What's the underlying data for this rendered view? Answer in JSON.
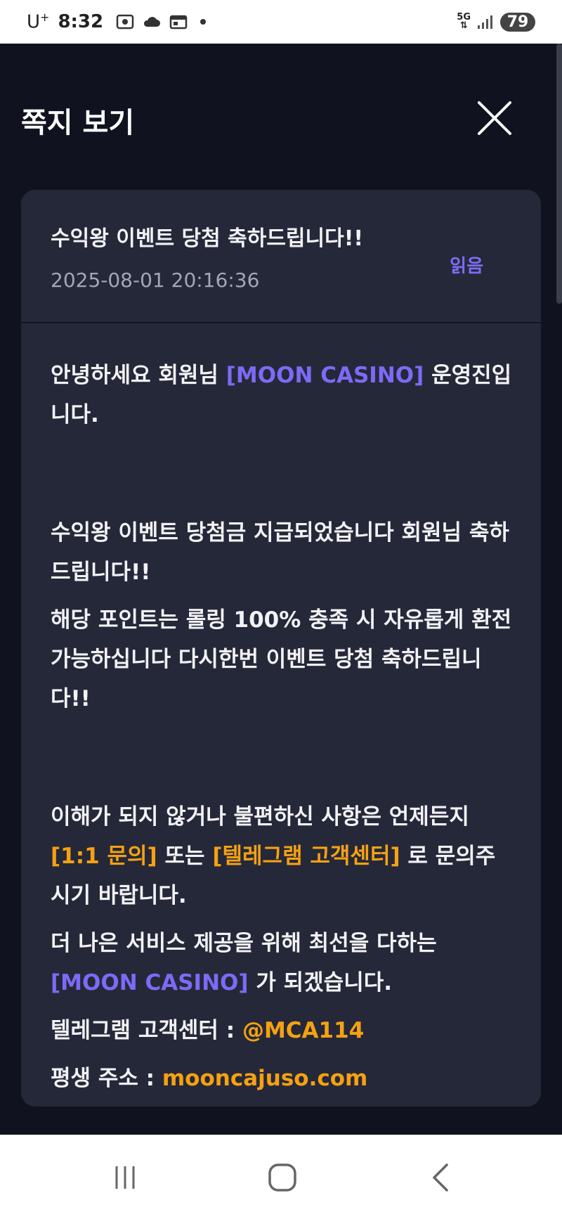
{
  "status_bar": {
    "carrier": "U",
    "carrier_sup": "+",
    "time": "8:32",
    "network": "5G",
    "battery": "79"
  },
  "header": {
    "title": "쪽지 보기",
    "close_icon": "close-icon"
  },
  "message": {
    "title": "수익왕 이벤트 당첨 축하드립니다!!",
    "datetime": "2025-08-01 20:16:36",
    "status": "읽음",
    "body": {
      "p1_a": "안녕하세요 회원님 ",
      "p1_brand": "[MOON CASINO]",
      "p1_b": " 운영진입니다.",
      "p2": "수익왕 이벤트 당첨금 지급되었습니다 회원님 축하드립니다!!",
      "p3": "해당 포인트는 롤링 100% 충족 시 자유롭게 환전 가능하십니다 다시한번 이벤트 당첨 축하드립니다!!",
      "p4_a": "이해가 되지 않거나 불편하신 사항은 언제든지 ",
      "p4_link1": "[1:1 문의]",
      "p4_b": " 또는 ",
      "p4_link2": "[텔레그램 고객센터]",
      "p4_c": " 로 문의주시기 바랍니다.",
      "p5_a": "더 나은 서비스 제공을 위해 최선을 다하는 ",
      "p5_brand": "[MOON CASINO]",
      "p5_b": " 가 되겠습니다.",
      "telegram_label": "텔레그램 고객센터 : ",
      "telegram_value": "@MCA114",
      "address_label": "평생 주소 : ",
      "address_value": "mooncajuso.com"
    }
  },
  "colors": {
    "background": "#10131f",
    "card": "#252839",
    "accent_purple": "#7d6af5",
    "accent_orange": "#f5a113"
  }
}
